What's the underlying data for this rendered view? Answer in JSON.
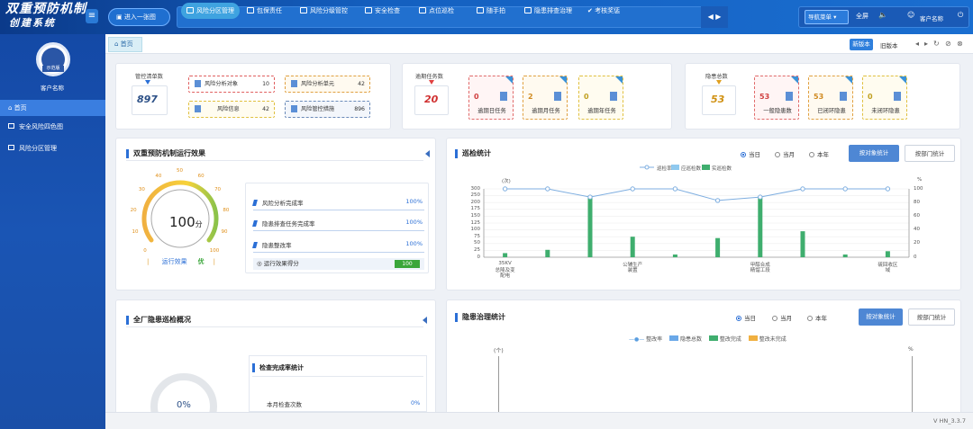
{
  "app": {
    "title_line1": "双重预防机制",
    "title_line2": "创建系统",
    "menu_glyph": "≡"
  },
  "header": {
    "quick_entry": "进入一张图",
    "nav": [
      "风险分区管理",
      "包保责任",
      "风险分级管控",
      "安全检查",
      "点位巡检",
      "随手拍",
      "隐患排查治理",
      "考核奖惩"
    ],
    "active_nav": 0,
    "nav_arrows": "◀ ▶",
    "nav_menu": "导航菜单",
    "nav_menu_caret": "▾",
    "fullscreen": "全屏",
    "volume_glyph": "🔈",
    "user_glyph": "☺",
    "customer": "客户名称",
    "power_glyph": "⏻"
  },
  "sidebar": {
    "badge_text": "示范版",
    "customer": "客户名称",
    "items": [
      {
        "label": "首页"
      },
      {
        "label": "安全风险四色图"
      },
      {
        "label": "风险分区管理"
      }
    ]
  },
  "tabs": {
    "home": "首页",
    "new_version": "新版本",
    "old_version": "旧版本",
    "controls": [
      "◂",
      "▸",
      "↻",
      "⊘",
      "⊗"
    ]
  },
  "stats": {
    "control_list": {
      "label": "管控清单数",
      "value": "897"
    },
    "mini_items": [
      {
        "label": "风险分析对象",
        "value": "10"
      },
      {
        "label": "风险分析单元",
        "value": "42"
      },
      {
        "label": "风险信息",
        "value": "42"
      },
      {
        "label": "风险管控措施",
        "value": "896"
      }
    ],
    "overdue": {
      "label": "逾期任务数",
      "value": "20"
    },
    "overdue_items": [
      {
        "value": "0",
        "label": "逾期日任务"
      },
      {
        "value": "2",
        "label": "逾期月任务"
      },
      {
        "value": "0",
        "label": "逾期年任务"
      }
    ],
    "hazard": {
      "label": "隐患总数",
      "value": "53"
    },
    "hazard_items": [
      {
        "value": "53",
        "label": "一般隐患数"
      },
      {
        "value": "53",
        "label": "已闭环隐患"
      },
      {
        "value": "0",
        "label": "未闭环隐患"
      }
    ]
  },
  "effect": {
    "title": "双重预防机制运行效果",
    "gauge_value": "100",
    "gauge_unit": "分",
    "gauge_ticks": [
      "0",
      "10",
      "20",
      "30",
      "40",
      "50",
      "60",
      "70",
      "80",
      "90",
      "100"
    ],
    "status_label": "运行效果",
    "status_value": "优",
    "rows": [
      {
        "label": "风险分析完成率",
        "value": "100%"
      },
      {
        "label": "隐患排查任务完成率",
        "value": "100%"
      },
      {
        "label": "隐患整改率",
        "value": "100%"
      }
    ],
    "score_label": "运行效果得分",
    "score_value": "100"
  },
  "inspection": {
    "title": "巡检统计",
    "radios": [
      "当日",
      "当月",
      "本年"
    ],
    "radio_selected": 0,
    "btn_object": "按对象统计",
    "btn_dept": "按部门统计",
    "chart_data": {
      "type": "bar",
      "legend": [
        "巡检率",
        "应巡检数",
        "实巡检数"
      ],
      "y_left_unit": "(次)",
      "y_right_unit": "%",
      "y_left_ticks": [
        "0",
        "25",
        "50",
        "75",
        "100",
        "125",
        "150",
        "175",
        "200",
        "250",
        "300"
      ],
      "y_right_ticks": [
        "0",
        "20",
        "40",
        "60",
        "80",
        "100"
      ],
      "x_labels": [
        [
          "35KV",
          "总降及变",
          "配电"
        ],
        [],
        [],
        [
          "公辅生产",
          "装置"
        ],
        [],
        [],
        [
          "甲醇合成",
          "精馏工段"
        ],
        [],
        [],
        [
          "硫回收区",
          "域"
        ]
      ],
      "series": [
        {
          "name": "巡检率",
          "values": [
            100,
            100,
            88,
            100,
            100,
            83,
            88,
            100,
            100,
            100
          ]
        },
        {
          "name": "实巡检数",
          "values": [
            15,
            27,
            250,
            75,
            10,
            70,
            245,
            95,
            10,
            22
          ]
        }
      ],
      "ylim": [
        0,
        300
      ],
      "y2lim": [
        0,
        100
      ]
    }
  },
  "hazard_overview": {
    "title": "全厂隐患巡检概况",
    "donut_value": "0%",
    "inner_title": "检查完成率统计",
    "row_label": "本月检查次数",
    "row_value": "0%"
  },
  "hazard_gov": {
    "title": "隐患治理统计",
    "radios": [
      "当日",
      "当月",
      "本年"
    ],
    "radio_selected": 0,
    "btn_object": "按对象统计",
    "btn_dept": "按部门统计",
    "legend": [
      "整改率",
      "隐患总数",
      "整改完成",
      "整改未完成"
    ],
    "y_left_unit": "(个)",
    "y_right_unit": "%"
  },
  "status_bar": {
    "version": "V HN_3.3.7"
  },
  "colors": {
    "primary": "#2b6fd6",
    "sky_bar": "#8fc9ef",
    "green_bar": "#3fae6e",
    "orange_bar": "#f0b040",
    "line": "#7eaee0"
  }
}
